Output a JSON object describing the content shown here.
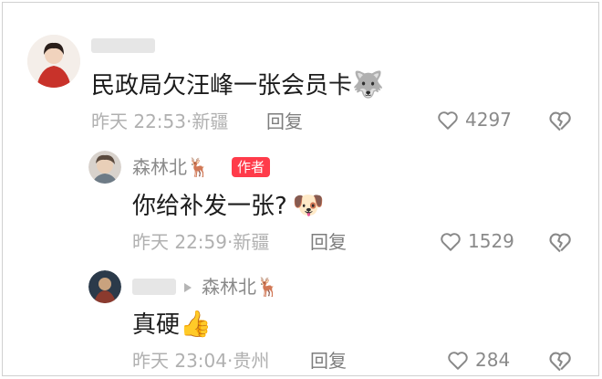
{
  "comments": [
    {
      "text": "民政局欠汪峰一张会员卡",
      "emoji": "🐺",
      "time": "昨天 22:53",
      "location": "新疆",
      "reply_label": "回复",
      "likes": "4297"
    },
    {
      "author": "森林北",
      "author_emoji": "🦌",
      "badge": "作者",
      "text": "你给补发一张?",
      "emoji": "🐶",
      "time": "昨天 22:59",
      "location": "新疆",
      "reply_label": "回复",
      "likes": "1529"
    },
    {
      "reply_to": "森林北",
      "reply_to_emoji": "🦌",
      "text": "真硬",
      "emoji": "👍",
      "time": "昨天 23:04",
      "location": "贵州",
      "reply_label": "回复",
      "likes": "284"
    }
  ],
  "separator": "·",
  "icons": {
    "like": "heart-outline-icon",
    "dislike": "broken-heart-icon",
    "reply_arrow": "triangle-right-icon"
  }
}
